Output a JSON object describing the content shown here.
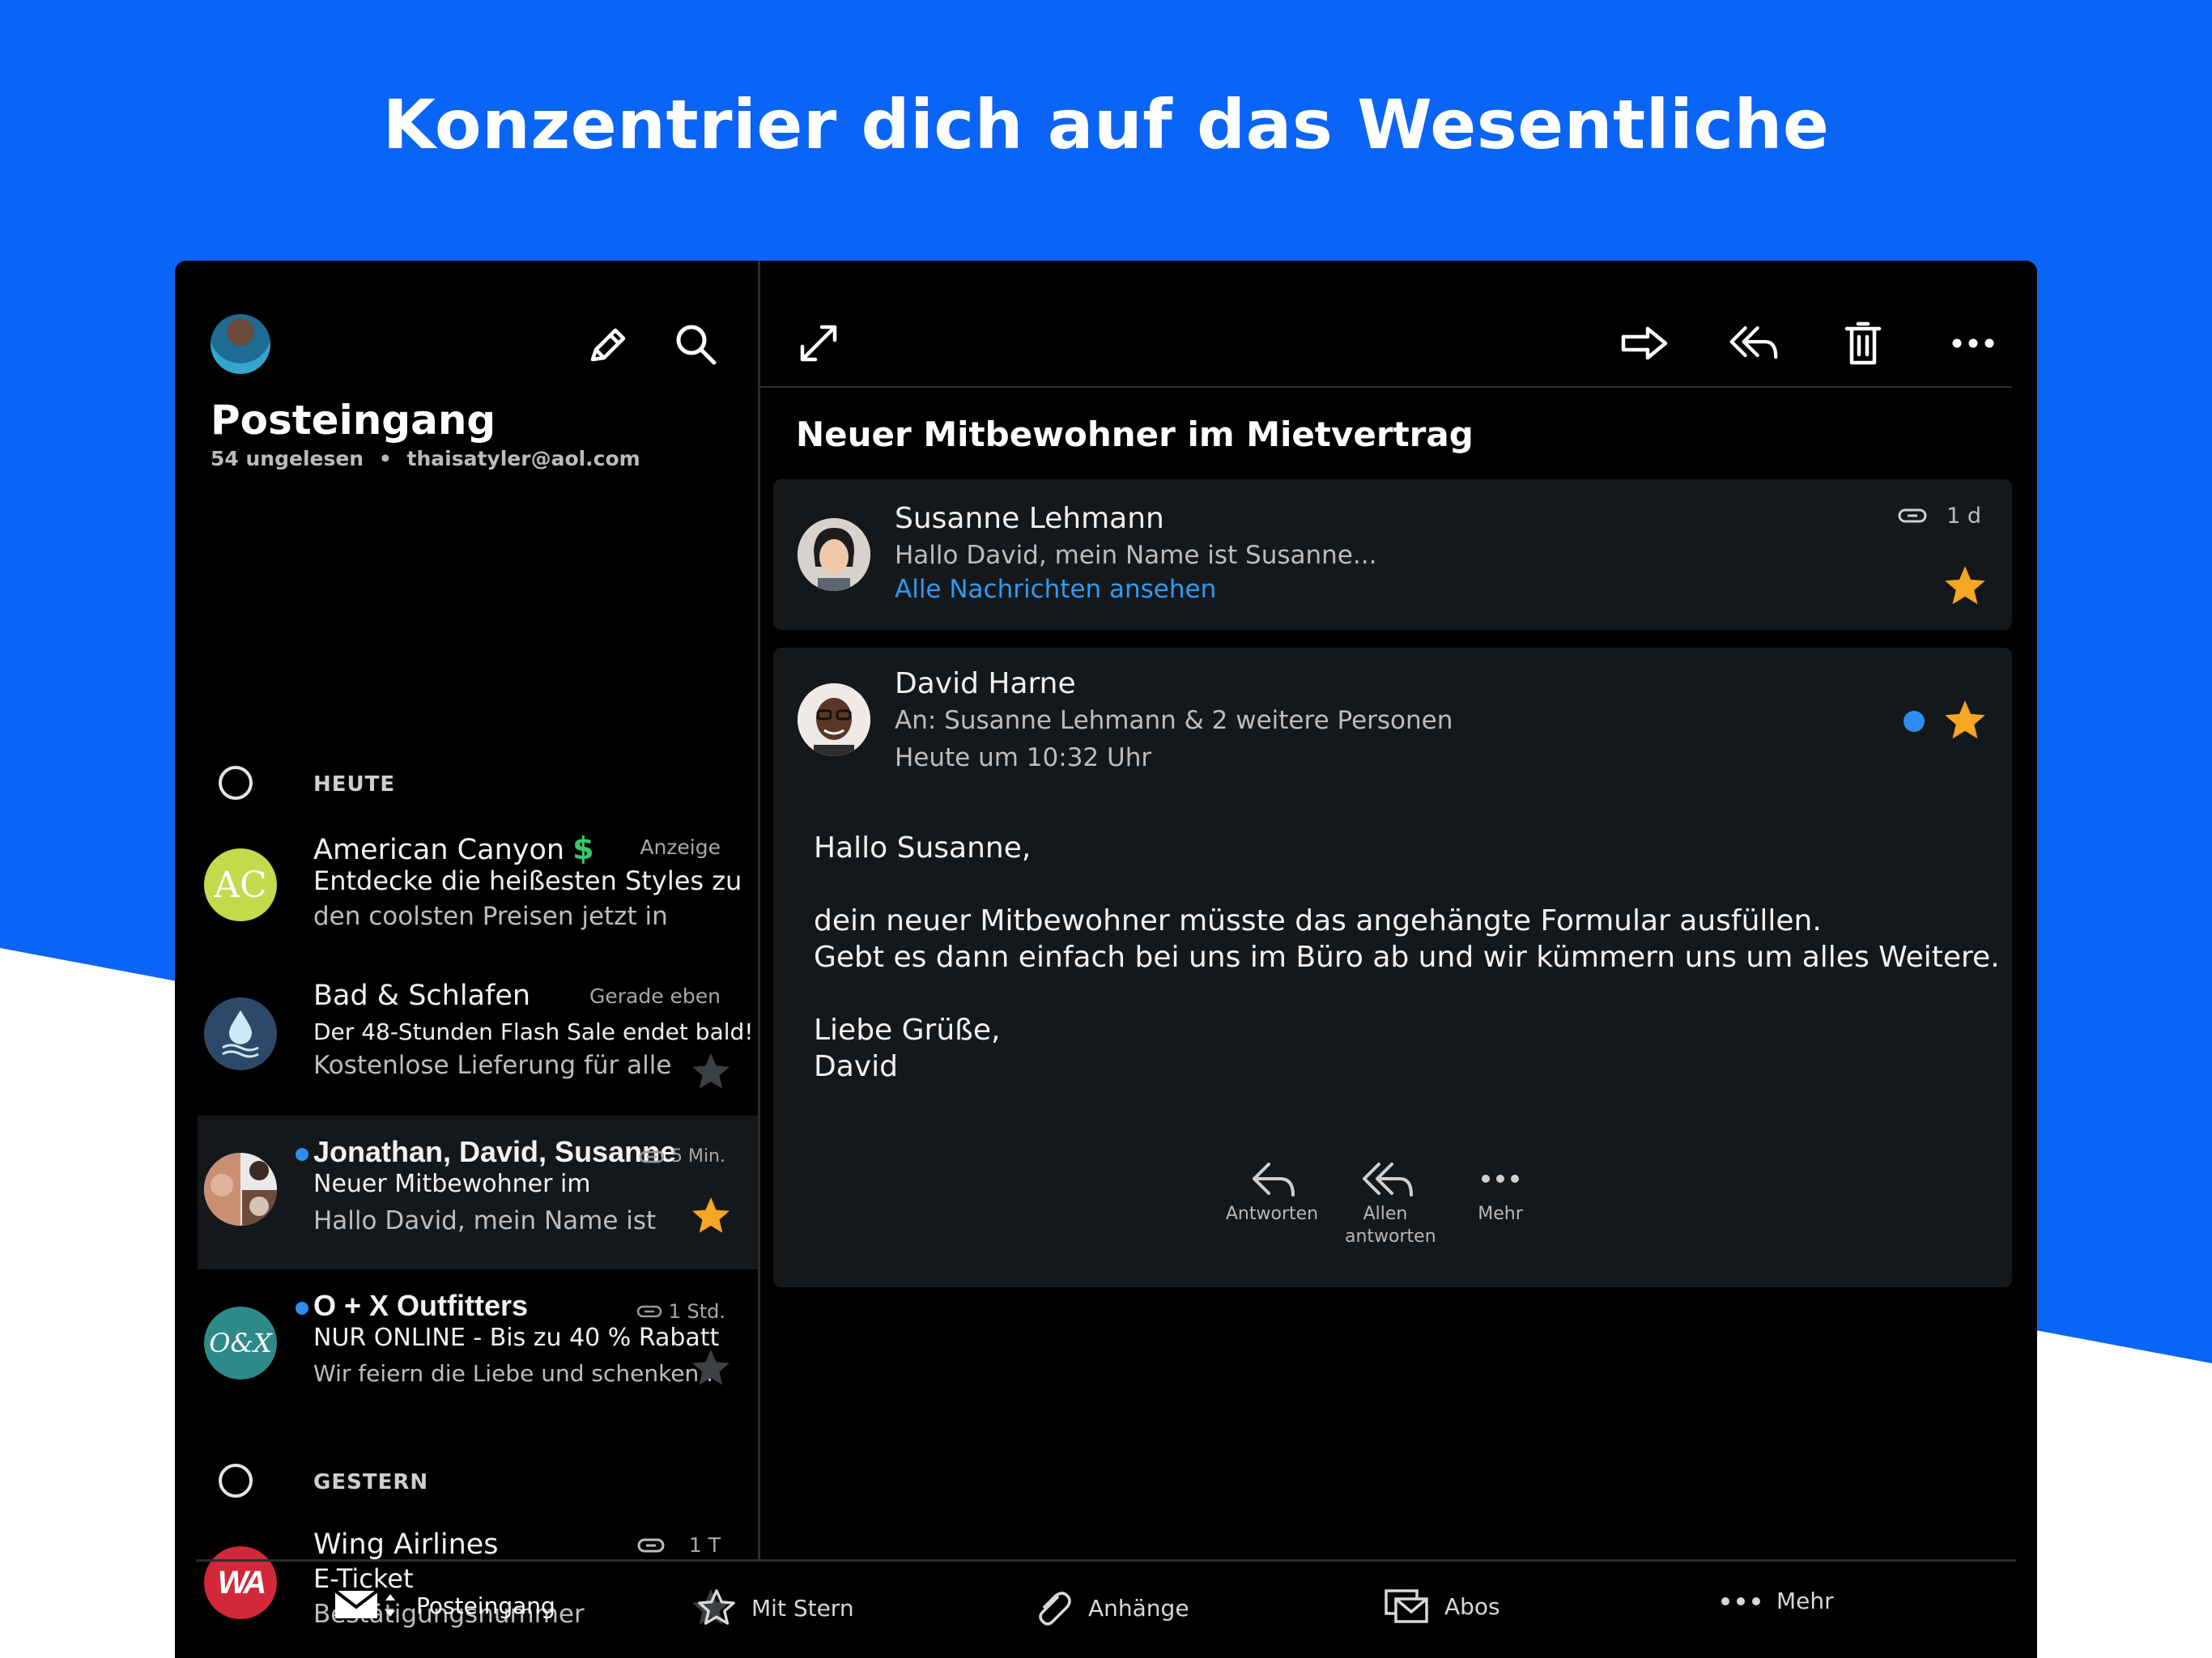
{
  "headline": "Konzentrier dich auf das Wesentliche",
  "inbox": {
    "title": "Posteingang",
    "unread": "54 ungelesen",
    "separator": "•",
    "account": "thaisatyler@aol.com"
  },
  "sections": {
    "today": "HEUTE",
    "yesterday": "GESTERN"
  },
  "mails": [
    {
      "from": "American Canyon",
      "badge": "Anzeige",
      "subject": "Entdecke die heißesten Styles zu",
      "snippet": "den coolsten Preisen jetzt in",
      "avatar_text": "AC"
    },
    {
      "from": "Bad & Schlafen",
      "time": "Gerade eben",
      "subject": "Der 48-Stunden Flash Sale endet bald!",
      "snippet": "Kostenlose Lieferung für alle"
    },
    {
      "from": "Jonathan, David, Susanne",
      "time": "5 Min.",
      "subject": "Neuer Mitbewohner im",
      "snippet": "Hallo David, mein Name ist"
    },
    {
      "from": "O + X Outfitters",
      "time": "1 Std.",
      "subject": "NUR ONLINE - Bis zu 40 % Rabatt",
      "snippet": "Wir feiern die Liebe und schenken...",
      "avatar_text": "O&X"
    },
    {
      "from": "Wing Airlines",
      "time": "1 T",
      "subject": "E-Ticket",
      "snippet": "Bestätigungsnummer",
      "avatar_text": "WA"
    }
  ],
  "thread": {
    "subject": "Neuer Mitbewohner im Mietvertrag",
    "first": {
      "sender": "Susanne Lehmann",
      "preview": "Hallo David, mein Name ist Susanne...",
      "link": "Alle Nachrichten ansehen",
      "time": "1 d"
    },
    "second": {
      "sender": "David Harne",
      "to": "An: Susanne Lehmann & 2 weitere Personen",
      "time": "Heute um 10:32 Uhr",
      "body": "Hallo Susanne,\n\ndein neuer Mitbewohner müsste das angehängte Formular ausfüllen.\nGebt es dann einfach bei uns im Büro ab und wir kümmern uns um alles Weitere.\n\nLiebe Grüße,\nDavid",
      "actions": {
        "reply": "Antworten",
        "reply_all": "Allen antworten",
        "more": "Mehr"
      }
    }
  },
  "nav": {
    "inbox": "Posteingang",
    "starred": "Mit Stern",
    "attachments": "Anhänge",
    "subscriptions": "Abos",
    "more": "Mehr"
  },
  "colors": {
    "brand_blue": "#0a64f5",
    "star": "#f5a623",
    "unread_dot": "#2f8cf0",
    "link": "#2f9bf2",
    "promo_green": "#37c96b"
  },
  "icons": {
    "compose": "pencil-icon",
    "search": "search-icon",
    "expand": "expand-icon",
    "forward": "forward-icon",
    "reply_all": "reply-all-icon",
    "delete": "trash-icon",
    "more": "more-icon",
    "attachment": "paperclip-icon",
    "star": "star-icon"
  }
}
